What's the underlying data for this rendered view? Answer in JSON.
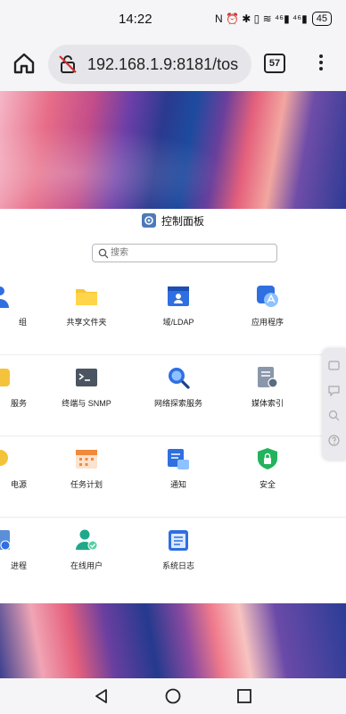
{
  "status": {
    "time": "14:22",
    "icons": "N ⏰ ✱ ▯ ≋ ⁴⁶▮ ⁴⁶▮",
    "battery": "45"
  },
  "browser": {
    "url": "192.168.1.9:8181/tos",
    "tab_count": "57"
  },
  "panel": {
    "title": "控制面板",
    "search_placeholder": "搜索",
    "rows": [
      {
        "tiles": [
          {
            "label": "组",
            "icon": "group-icon"
          },
          {
            "label": "共享文件夹",
            "icon": "folder-icon"
          },
          {
            "label": "域/LDAP",
            "icon": "domain-ldap-icon"
          },
          {
            "label": "应用程序",
            "icon": "app-icon"
          }
        ]
      },
      {
        "tiles": [
          {
            "label": "服务",
            "icon": "service-icon"
          },
          {
            "label": "终端与 SNMP",
            "icon": "terminal-icon"
          },
          {
            "label": "网络探索服务",
            "icon": "network-discovery-icon"
          },
          {
            "label": "媒体索引",
            "icon": "media-index-icon"
          }
        ]
      },
      {
        "tiles": [
          {
            "label": "电源",
            "icon": "power-icon"
          },
          {
            "label": "任务计划",
            "icon": "calendar-icon"
          },
          {
            "label": "通知",
            "icon": "notification-icon"
          },
          {
            "label": "安全",
            "icon": "shield-icon"
          }
        ]
      },
      {
        "tiles": [
          {
            "label": "进程",
            "icon": "process-icon"
          },
          {
            "label": "在线用户",
            "icon": "online-users-icon"
          },
          {
            "label": "系统日志",
            "icon": "system-log-icon"
          }
        ]
      }
    ]
  },
  "colors": {
    "accent": "#2f6fe0",
    "folder": "#f7c634",
    "shield": "#22b35c",
    "calendar": "#f08a3c"
  }
}
